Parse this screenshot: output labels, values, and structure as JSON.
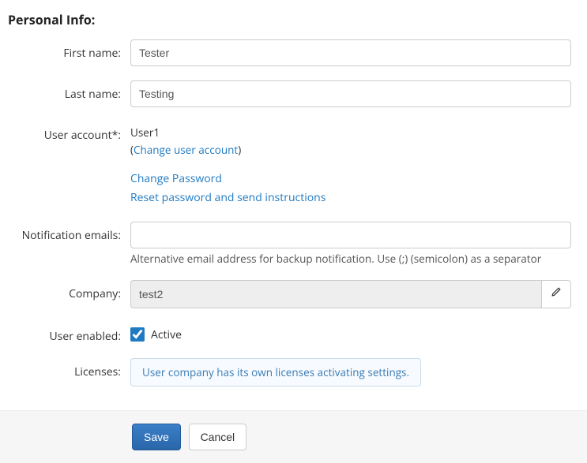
{
  "section_title": "Personal Info:",
  "fields": {
    "first_name": {
      "label": "First name:",
      "value": "Tester"
    },
    "last_name": {
      "label": "Last name:",
      "value": "Testing"
    },
    "user_account": {
      "label": "User account*:",
      "username": "User1",
      "change_account_link": "Change user account",
      "change_password_link": "Change Password",
      "reset_password_link": "Reset password and send instructions"
    },
    "notification_emails": {
      "label": "Notification emails:",
      "value": "",
      "help": "Alternative email address for backup notification. Use (;) (semicolon) as a separator"
    },
    "company": {
      "label": "Company:",
      "value": "test2"
    },
    "user_enabled": {
      "label": "User enabled:",
      "checkbox_label": "Active",
      "checked": true
    },
    "licenses": {
      "label": "Licenses:",
      "info": "User company has its own licenses activating settings."
    }
  },
  "buttons": {
    "save": "Save",
    "cancel": "Cancel"
  }
}
